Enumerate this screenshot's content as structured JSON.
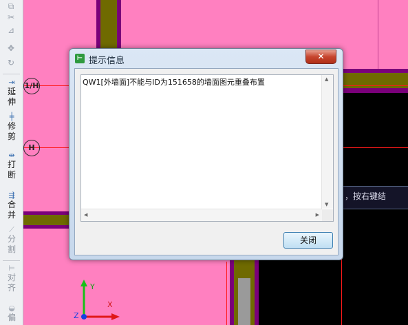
{
  "toolbar": {
    "items": [
      {
        "name": "extend",
        "label1": "延",
        "label2": "伸",
        "disabled": false
      },
      {
        "name": "trim",
        "label1": "修",
        "label2": "剪",
        "disabled": false
      },
      {
        "name": "break",
        "label1": "打",
        "label2": "断",
        "disabled": false
      },
      {
        "name": "merge",
        "label1": "合",
        "label2": "并",
        "disabled": false
      },
      {
        "name": "split",
        "label1": "分",
        "label2": "割",
        "disabled": true
      },
      {
        "name": "align",
        "label1": "对",
        "label2": "齐",
        "disabled": true
      },
      {
        "name": "offset",
        "label1": "偏",
        "label2": "",
        "disabled": true
      }
    ]
  },
  "canvas": {
    "axis_labels": [
      "1/H",
      "H"
    ],
    "hint_partial": "，按右键结",
    "ucs": {
      "x": "X",
      "y": "Y",
      "z": "Z"
    },
    "colors": {
      "background": "#ff80c0",
      "wall_dark": "#7a007a",
      "wall_olive": "#6f6a00",
      "void": "#000000",
      "axis_line": "#ff1a1a"
    }
  },
  "dialog": {
    "title": "提示信息",
    "message": "QW1[外墙面]不能与ID为151658的墙面图元重叠布置",
    "close_button": "关闭"
  }
}
